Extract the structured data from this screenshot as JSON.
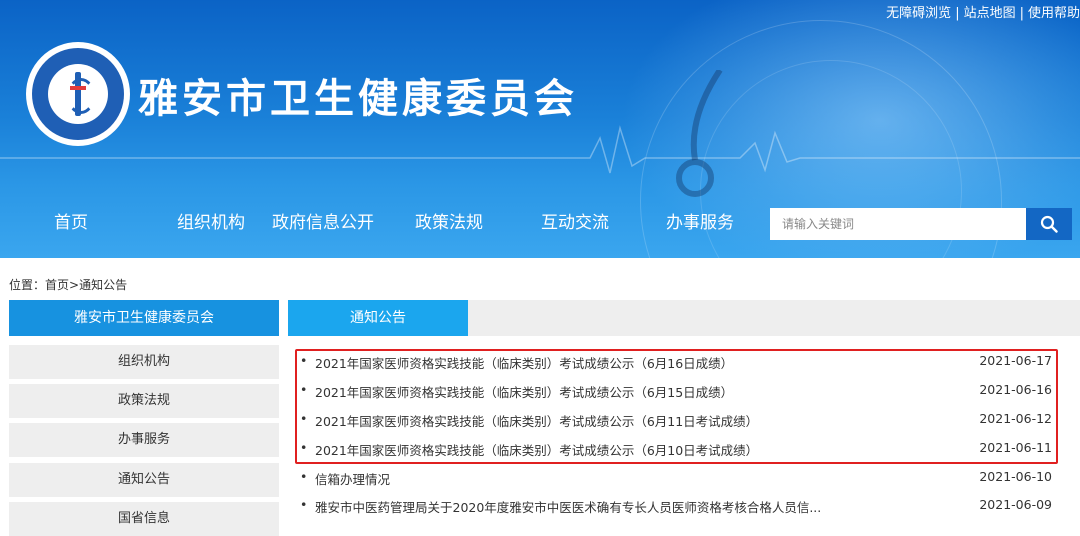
{
  "top_links": [
    "无障碍浏览",
    "站点地图",
    "使用帮助"
  ],
  "top_link_sep": "|",
  "site_title": "雅安市卫生健康委员会",
  "nav": [
    "首页",
    "组织机构",
    "政府信息公开",
    "政策法规",
    "互动交流",
    "办事服务"
  ],
  "search": {
    "placeholder": "请输入关键词",
    "icon": "search-icon"
  },
  "breadcrumb": {
    "prefix": "位置：",
    "home": "首页",
    "sep": ">",
    "current": "通知公告"
  },
  "sidebar": {
    "header": "雅安市卫生健康委员会",
    "items": [
      "组织机构",
      "政策法规",
      "办事服务",
      "通知公告",
      "国省信息"
    ]
  },
  "main": {
    "tab": "通知公告",
    "bullet": "•",
    "list": [
      {
        "title": "2021年国家医师资格实践技能（临床类别）考试成绩公示（6月16日成绩）",
        "date": "2021-06-17"
      },
      {
        "title": "2021年国家医师资格实践技能（临床类别）考试成绩公示（6月15日成绩）",
        "date": "2021-06-16"
      },
      {
        "title": "2021年国家医师资格实践技能（临床类别）考试成绩公示（6月11日考试成绩）",
        "date": "2021-06-12"
      },
      {
        "title": "2021年国家医师资格实践技能（临床类别）考试成绩公示（6月10日考试成绩）",
        "date": "2021-06-11"
      },
      {
        "title": "信箱办理情况",
        "date": "2021-06-10"
      },
      {
        "title": "雅安市中医药管理局关于2020年度雅安市中医医术确有专长人员医师资格考核合格人员信...",
        "date": "2021-06-09"
      }
    ]
  },
  "colors": {
    "banner": "#1a80d8",
    "nav_text": "#ffffff",
    "sidebar_head": "#1792e0",
    "tab_active": "#1ba6ee",
    "highlight": "#e02020"
  }
}
